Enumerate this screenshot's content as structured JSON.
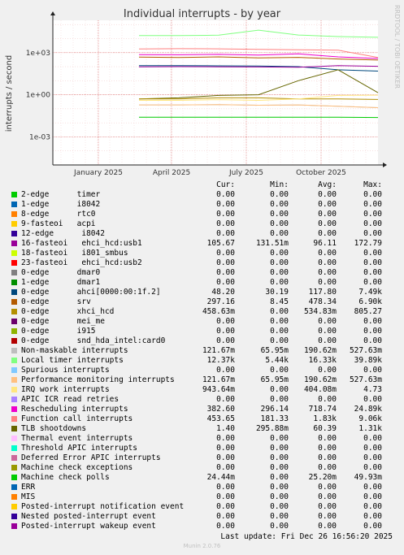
{
  "title": "Individual interrupts - by year",
  "side_credit": "RRDTOOL / TOBI OETIKER",
  "footer": {
    "last_update": "Last update: Fri Dec 26 16:56:20 2025",
    "munin": "Munin 2.0.76"
  },
  "legend_headers": {
    "cur": "Cur:",
    "min": "Min:",
    "avg": "Avg:",
    "max": "Max:"
  },
  "legend": [
    {
      "name": "2-edge      timer",
      "color": "#00cc00",
      "cur": "0.00",
      "min": "0.00",
      "avg": "0.00",
      "max": "0.00"
    },
    {
      "name": "1-edge      i8042",
      "color": "#0066b3",
      "cur": "0.00",
      "min": "0.00",
      "avg": "0.00",
      "max": "0.00"
    },
    {
      "name": "8-edge      rtc0",
      "color": "#ff8000",
      "cur": "0.00",
      "min": "0.00",
      "avg": "0.00",
      "max": "0.00"
    },
    {
      "name": "9-fasteoi   acpi",
      "color": "#ffcc00",
      "cur": "0.00",
      "min": "0.00",
      "avg": "0.00",
      "max": "0.00"
    },
    {
      "name": "12-edge      i8042",
      "color": "#330099",
      "cur": "0.00",
      "min": "0.00",
      "avg": "0.00",
      "max": "0.00"
    },
    {
      "name": "16-fasteoi   ehci_hcd:usb1",
      "color": "#990099",
      "cur": "105.67",
      "min": "131.51m",
      "avg": "96.11",
      "max": "172.79"
    },
    {
      "name": "18-fasteoi   i801_smbus",
      "color": "#ccff00",
      "cur": "0.00",
      "min": "0.00",
      "avg": "0.00",
      "max": "0.00"
    },
    {
      "name": "23-fasteoi   ehci_hcd:usb2",
      "color": "#ff0000",
      "cur": "0.00",
      "min": "0.00",
      "avg": "0.00",
      "max": "0.00"
    },
    {
      "name": "0-edge      dmar0",
      "color": "#808080",
      "cur": "0.00",
      "min": "0.00",
      "avg": "0.00",
      "max": "0.00"
    },
    {
      "name": "1-edge      dmar1",
      "color": "#008f00",
      "cur": "0.00",
      "min": "0.00",
      "avg": "0.00",
      "max": "0.00"
    },
    {
      "name": "0-edge      ahci[0000:00:1f.2]",
      "color": "#00487d",
      "cur": "48.20",
      "min": "30.19",
      "avg": "117.80",
      "max": "7.49k"
    },
    {
      "name": "0-edge      srv",
      "color": "#b35a00",
      "cur": "297.16",
      "min": "8.45",
      "avg": "478.34",
      "max": "6.90k"
    },
    {
      "name": "0-edge      xhci_hcd",
      "color": "#b38f00",
      "cur": "458.63m",
      "min": "0.00",
      "avg": "534.83m",
      "max": "805.27"
    },
    {
      "name": "0-edge      mei_me",
      "color": "#6b006b",
      "cur": "0.00",
      "min": "0.00",
      "avg": "0.00",
      "max": "0.00"
    },
    {
      "name": "0-edge      i915",
      "color": "#8fb300",
      "cur": "0.00",
      "min": "0.00",
      "avg": "0.00",
      "max": "0.00"
    },
    {
      "name": "0-edge      snd_hda_intel:card0",
      "color": "#b30000",
      "cur": "0.00",
      "min": "0.00",
      "avg": "0.00",
      "max": "0.00"
    },
    {
      "name": "Non-maskable interrupts",
      "color": "#bebebe",
      "cur": "121.67m",
      "min": "65.95m",
      "avg": "190.62m",
      "max": "527.63m"
    },
    {
      "name": "Local timer interrupts",
      "color": "#80ff80",
      "cur": "12.37k",
      "min": "5.44k",
      "avg": "16.33k",
      "max": "39.89k"
    },
    {
      "name": "Spurious interrupts",
      "color": "#80c9ff",
      "cur": "0.00",
      "min": "0.00",
      "avg": "0.00",
      "max": "0.00"
    },
    {
      "name": "Performance monitoring interrupts",
      "color": "#ffc080",
      "cur": "121.67m",
      "min": "65.95m",
      "avg": "190.62m",
      "max": "527.63m"
    },
    {
      "name": "IRQ work interrupts",
      "color": "#ffe680",
      "cur": "943.64m",
      "min": "0.00",
      "avg": "404.08m",
      "max": "4.73"
    },
    {
      "name": "APIC ICR read retries",
      "color": "#aa80ff",
      "cur": "0.00",
      "min": "0.00",
      "avg": "0.00",
      "max": "0.00"
    },
    {
      "name": "Rescheduling interrupts",
      "color": "#ee00cc",
      "cur": "382.60",
      "min": "296.14",
      "avg": "718.74",
      "max": "24.89k"
    },
    {
      "name": "Function call interrupts",
      "color": "#ff8080",
      "cur": "453.65",
      "min": "181.33",
      "avg": "1.83k",
      "max": "9.06k"
    },
    {
      "name": "TLB shootdowns",
      "color": "#666600",
      "cur": "1.40",
      "min": "295.88m",
      "avg": "60.39",
      "max": "1.31k"
    },
    {
      "name": "Thermal event interrupts",
      "color": "#ffbfff",
      "cur": "0.00",
      "min": "0.00",
      "avg": "0.00",
      "max": "0.00"
    },
    {
      "name": "Threshold APIC interrupts",
      "color": "#00ffcc",
      "cur": "0.00",
      "min": "0.00",
      "avg": "0.00",
      "max": "0.00"
    },
    {
      "name": "Deferred Error APIC interrupts",
      "color": "#cc6699",
      "cur": "0.00",
      "min": "0.00",
      "avg": "0.00",
      "max": "0.00"
    },
    {
      "name": "Machine check exceptions",
      "color": "#999900",
      "cur": "0.00",
      "min": "0.00",
      "avg": "0.00",
      "max": "0.00"
    },
    {
      "name": "Machine check polls",
      "color": "#00cc00",
      "cur": "24.44m",
      "min": "0.00",
      "avg": "25.20m",
      "max": "49.93m"
    },
    {
      "name": "ERR",
      "color": "#0066b3",
      "cur": "0.00",
      "min": "0.00",
      "avg": "0.00",
      "max": "0.00"
    },
    {
      "name": "MIS",
      "color": "#ff8000",
      "cur": "0.00",
      "min": "0.00",
      "avg": "0.00",
      "max": "0.00"
    },
    {
      "name": "Posted-interrupt notification event",
      "color": "#ffcc00",
      "cur": "0.00",
      "min": "0.00",
      "avg": "0.00",
      "max": "0.00"
    },
    {
      "name": "Nested posted-interrupt event",
      "color": "#330099",
      "cur": "0.00",
      "min": "0.00",
      "avg": "0.00",
      "max": "0.00"
    },
    {
      "name": "Posted-interrupt wakeup event",
      "color": "#990099",
      "cur": "0.00",
      "min": "0.00",
      "avg": "0.00",
      "max": "0.00"
    }
  ],
  "chart_data": {
    "type": "line",
    "title": "Individual interrupts - by year",
    "ylabel": "interrupts / second",
    "yscale": "log",
    "y_ticks": [
      "1e+03",
      "1e+00",
      "1e-03"
    ],
    "x_ticks": [
      "January 2025",
      "April 2025",
      "July 2025",
      "October 2025"
    ],
    "ylim": [
      1e-05,
      200000
    ],
    "grid": true,
    "series": [
      {
        "name": "Local timer interrupts",
        "color": "#80ff80",
        "values": [
          16330,
          16300,
          17500,
          40000,
          18000,
          14000,
          12370
        ]
      },
      {
        "name": "Function call interrupts",
        "color": "#ff8080",
        "values": [
          1830,
          1900,
          1850,
          1700,
          1600,
          1500,
          453.65
        ]
      },
      {
        "name": "Rescheduling interrupts",
        "color": "#ee00cc",
        "values": [
          718,
          700,
          750,
          680,
          820,
          500,
          382.6
        ]
      },
      {
        "name": "0-edge srv",
        "color": "#b35a00",
        "values": [
          478,
          450,
          500,
          420,
          460,
          350,
          297.16
        ]
      },
      {
        "name": "0-edge ahci[0000:00:1f.2]",
        "color": "#00487d",
        "values": [
          117.8,
          120,
          115,
          110,
          100,
          60,
          48.2
        ]
      },
      {
        "name": "16-fasteoi ehci_hcd:usb1",
        "color": "#990099",
        "values": [
          96,
          100,
          98,
          95,
          90,
          120,
          105.67
        ]
      },
      {
        "name": "TLB shootdowns",
        "color": "#666600",
        "values": [
          0.5,
          0.6,
          0.9,
          1.0,
          10,
          60,
          1.4
        ]
      },
      {
        "name": "0-edge xhci_hcd",
        "color": "#b38f00",
        "values": [
          0.5,
          0.5,
          0.6,
          0.6,
          0.5,
          0.5,
          0.46
        ]
      },
      {
        "name": "IRQ work interrupts",
        "color": "#ffe680",
        "values": [
          0.4,
          0.4,
          0.45,
          0.4,
          0.5,
          0.9,
          0.94
        ]
      },
      {
        "name": "Non-maskable interrupts",
        "color": "#bebebe",
        "values": [
          0.19,
          0.19,
          0.2,
          0.18,
          0.19,
          0.15,
          0.12
        ]
      },
      {
        "name": "Performance monitoring interrupts",
        "color": "#ffc080",
        "values": [
          0.19,
          0.19,
          0.2,
          0.18,
          0.19,
          0.15,
          0.12
        ]
      },
      {
        "name": "Machine check polls",
        "color": "#00cc00",
        "values": [
          0.025,
          0.025,
          0.025,
          0.025,
          0.025,
          0.025,
          0.024
        ]
      }
    ]
  }
}
